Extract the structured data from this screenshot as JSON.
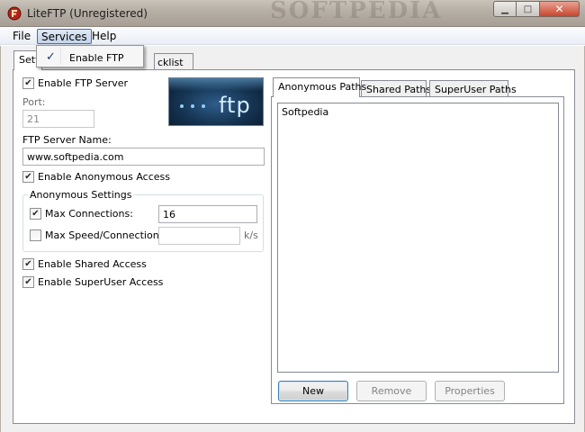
{
  "window": {
    "title": "LiteFTP (Unregistered)",
    "watermark": "SOFTPEDIA",
    "icon": "liteftp-app-icon"
  },
  "menubar": {
    "items": [
      "File",
      "Services",
      "Help"
    ]
  },
  "services_menu": {
    "items": [
      {
        "label": "Enable FTP",
        "checked": true
      }
    ]
  },
  "tabs": {
    "main": [
      "Setti",
      "cklist"
    ]
  },
  "settings": {
    "enable_ftp_label": "Enable FTP Server",
    "port_label": "Port:",
    "port_value": "21",
    "server_name_label": "FTP Server Name:",
    "server_name_value": "www.softpedia.com",
    "enable_anonymous_label": "Enable Anonymous Access",
    "anonymous_group_title": "Anonymous Settings",
    "max_connections_label": "Max Connections:",
    "max_connections_value": "16",
    "max_speed_label": "Max Speed/Connection:",
    "max_speed_value": "",
    "speed_unit": "k/s",
    "enable_shared_label": "Enable Shared Access",
    "enable_superuser_label": "Enable SuperUser Access",
    "logo_text": "ftp"
  },
  "paths": {
    "tabs": [
      "Anonymous Paths",
      "Shared Paths",
      "SuperUser Paths"
    ],
    "items": [
      "Softpedia"
    ],
    "buttons": {
      "new": "New",
      "remove": "Remove",
      "properties": "Properties"
    }
  },
  "colors": {
    "accent": "#4b6d98",
    "logo_bg": "#153452"
  }
}
